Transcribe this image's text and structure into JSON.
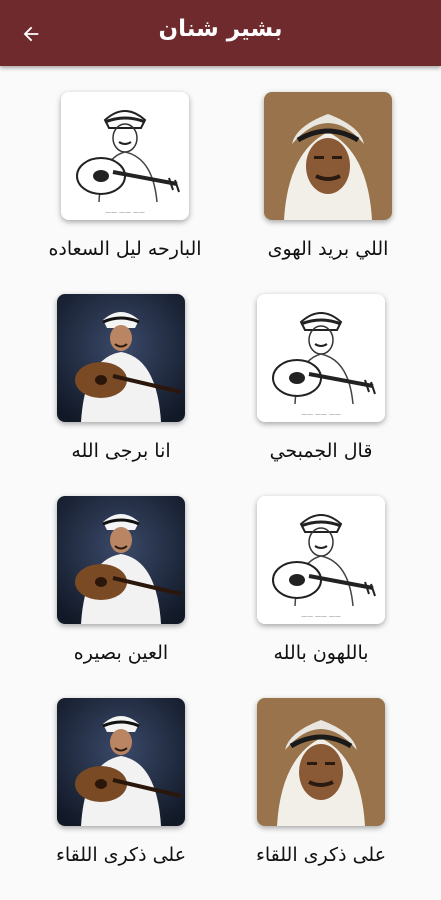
{
  "app": {
    "title": "بشير شنان",
    "back_icon": "arrow-left-icon",
    "bar_color": "#6e2a2d"
  },
  "songs": [
    {
      "title": "اللي بريد الهوى",
      "art": "portrait-photo"
    },
    {
      "title": "البارحه ليل السعاده",
      "art": "oud-sketch"
    },
    {
      "title": "قال الجمبحي",
      "art": "oud-sketch"
    },
    {
      "title": "انا برجى الله",
      "art": "oud-photo"
    },
    {
      "title": "باللهون بالله",
      "art": "oud-sketch"
    },
    {
      "title": "العين بصيره",
      "art": "oud-photo"
    },
    {
      "title": "على ذكرى اللقاء",
      "art": "portrait-photo"
    },
    {
      "title": "على ذكرى اللقاء",
      "art": "oud-photo"
    }
  ]
}
